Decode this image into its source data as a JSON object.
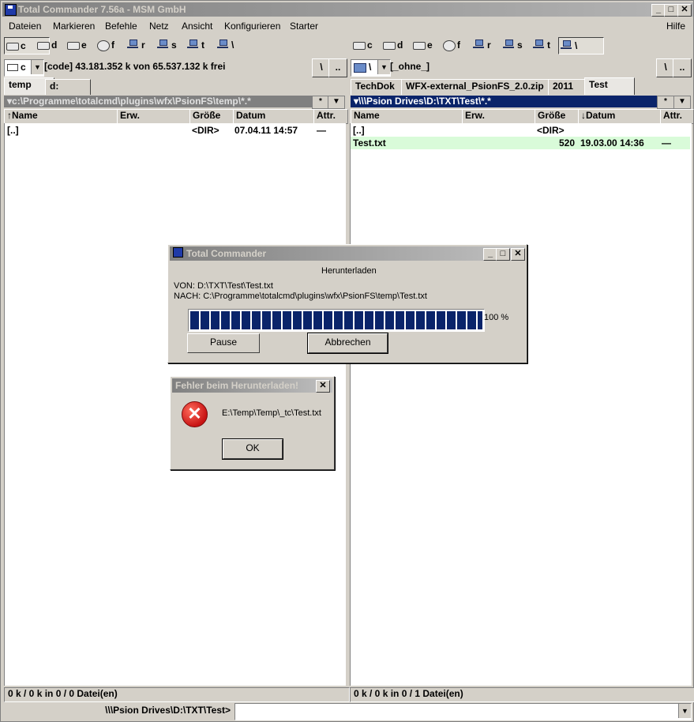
{
  "window": {
    "title": "Total Commander 7.56a - MSM GmbH"
  },
  "menu": {
    "items": [
      "Dateien",
      "Markieren",
      "Befehle",
      "Netz",
      "Ansicht",
      "Konfigurieren",
      "Starter"
    ],
    "help": "Hilfe"
  },
  "left": {
    "drives": [
      "c",
      "d",
      "e",
      "f",
      "r",
      "s",
      "t",
      "\\"
    ],
    "drive_combo": "c",
    "drive_info": "[code]  43.181.352 k von 65.537.132 k frei",
    "root_btn": "\\",
    "up_btn": "..",
    "tabs": [
      "temp",
      "d:"
    ],
    "path": "c:\\Programme\\totalcmd\\plugins\\wfx\\PsionFS\\temp\\*.*",
    "star_btn": "*",
    "columns": {
      "name": "Name",
      "ext": "Erw.",
      "size": "Größe",
      "date": "Datum",
      "attr": "Attr."
    },
    "files": [
      {
        "name": "[..]",
        "ext": "",
        "size": "<DIR>",
        "date": "07.04.11 14:57",
        "attr": "—"
      }
    ],
    "status": "0 k / 0 k in 0 / 0 Datei(en)"
  },
  "right": {
    "drives": [
      "c",
      "d",
      "e",
      "f",
      "r",
      "s",
      "t",
      "\\"
    ],
    "drive_combo": "\\",
    "drive_info": "[_ohne_]",
    "root_btn": "\\",
    "up_btn": "..",
    "tabs": [
      "TechDok",
      "WFX-external_PsionFS_2.0.zip",
      "2011",
      "Test"
    ],
    "path": "\\\\\\Psion Drives\\D:\\TXT\\Test\\*.*",
    "star_btn": "*",
    "columns": {
      "name": "Name",
      "ext": "Erw.",
      "size": "Größe",
      "date": "Datum",
      "attr": "Attr."
    },
    "files": [
      {
        "name": "[..]",
        "ext": "",
        "size": "<DIR>",
        "date": "",
        "attr": ""
      },
      {
        "name": "Test.txt",
        "ext": "",
        "size": "520",
        "date": "19.03.00 14:36",
        "attr": "—"
      }
    ],
    "status": "0 k / 0 k in 0 / 1 Datei(en)"
  },
  "cmdline": {
    "label": "\\\\\\Psion Drives\\D:\\TXT\\Test>"
  },
  "progress_dialog": {
    "title": "Total Commander",
    "heading": "Herunterladen",
    "from": "VON:  D:\\TXT\\Test\\Test.txt",
    "to": "NACH: C:\\Programme\\totalcmd\\plugins\\wfx\\PsionFS\\temp\\Test.txt",
    "progress_value": 100,
    "progress_label": "100 %",
    "pause_label": "Pause",
    "cancel_label": "Abbrechen"
  },
  "error_dialog": {
    "title": "Fehler beim Herunterladen!",
    "message": "E:\\Temp\\Temp\\_tc\\Test.txt",
    "ok_label": "OK"
  },
  "colors": {
    "active_header": "#0a246a",
    "selected_row": "#d9fbd9"
  }
}
